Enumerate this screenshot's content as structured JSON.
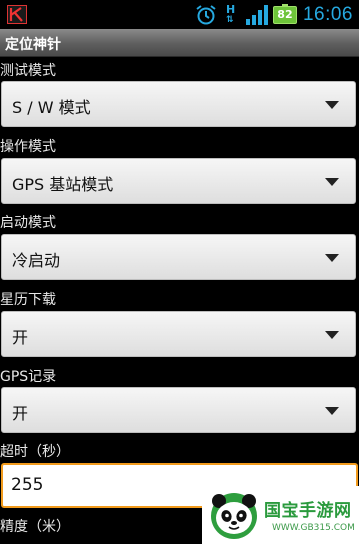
{
  "status_bar": {
    "network_label": "H",
    "battery_level": "82",
    "time": "16:06"
  },
  "title": "定位神针",
  "settings": {
    "test_mode": {
      "label": "测试模式",
      "value": "S / W 模式"
    },
    "operation_mode": {
      "label": "操作模式",
      "value": "GPS 基站模式"
    },
    "start_mode": {
      "label": "启动模式",
      "value": "冷启动"
    },
    "ephemeris_download": {
      "label": "星历下载",
      "value": "开"
    },
    "gps_record": {
      "label": "GPS记录",
      "value": "开"
    },
    "timeout": {
      "label": "超时（秒）",
      "value": "255"
    },
    "accuracy": {
      "label": "精度（米）"
    }
  },
  "watermark": {
    "title": "国宝手游网",
    "url": "WWW.GB315.COM"
  }
}
